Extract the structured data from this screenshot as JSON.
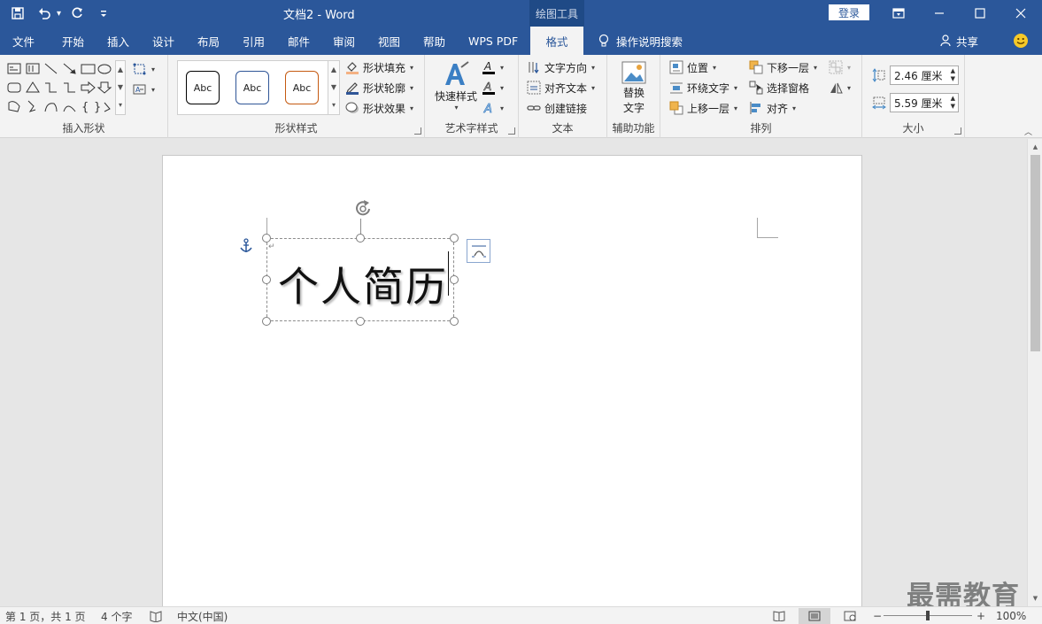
{
  "title_bar": {
    "doc_title": "文档2  -  Word",
    "context_tab_group": "绘图工具",
    "login_label": "登录"
  },
  "tabs": [
    {
      "label": "文件"
    },
    {
      "label": "开始"
    },
    {
      "label": "插入"
    },
    {
      "label": "设计"
    },
    {
      "label": "布局"
    },
    {
      "label": "引用"
    },
    {
      "label": "邮件"
    },
    {
      "label": "审阅"
    },
    {
      "label": "视图"
    },
    {
      "label": "帮助"
    },
    {
      "label": "WPS PDF"
    },
    {
      "label": "格式"
    }
  ],
  "active_tab": "格式",
  "tell_me": "操作说明搜索",
  "share": "共享",
  "ribbon": {
    "insert_shapes": {
      "label": "插入形状"
    },
    "shape_styles": {
      "label": "形状样式",
      "swatches": [
        "Abc",
        "Abc",
        "Abc"
      ],
      "fill": "形状填充",
      "outline": "形状轮廓",
      "effect": "形状效果"
    },
    "wordart": {
      "label": "艺术字样式",
      "quick_styles": "快速样式"
    },
    "text": {
      "label": "文本",
      "direction": "文字方向",
      "align": "对齐文本",
      "link": "创建链接"
    },
    "accessibility": {
      "label": "辅助功能",
      "alt_text_line1": "替换",
      "alt_text_line2": "文字"
    },
    "arrange": {
      "label": "排列",
      "position": "位置",
      "wrap": "环绕文字",
      "bring_forward": "上移一层",
      "send_backward": "下移一层",
      "selection_pane": "选择窗格",
      "align": "对齐"
    },
    "size": {
      "label": "大小",
      "height": "2.46 厘米",
      "width": "5.59 厘米"
    }
  },
  "document": {
    "textbox_text": "个人简历"
  },
  "watermark": "最需教育",
  "status": {
    "page": "第 1 页，共 1 页",
    "word_count": "4 个字",
    "language": "中文(中国)",
    "zoom": "100%"
  },
  "colors": {
    "brand": "#2b579a",
    "swatch1_border": "#000000",
    "swatch2_border": "#2f5597",
    "swatch3_border": "#c55a11"
  }
}
